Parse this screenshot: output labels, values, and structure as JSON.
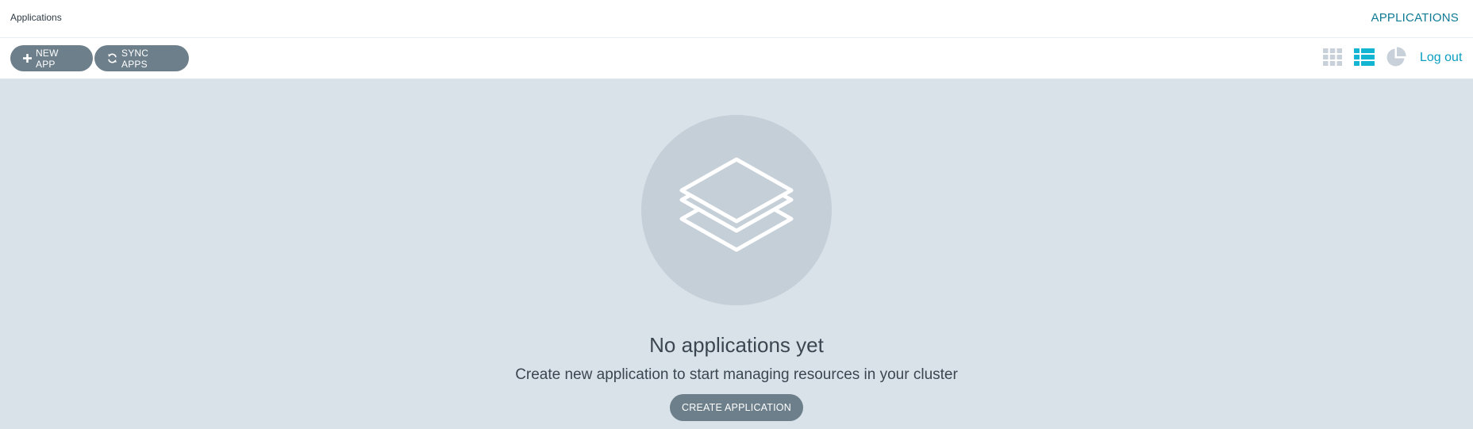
{
  "header": {
    "title": "Applications",
    "nav_link": "APPLICATIONS"
  },
  "toolbar": {
    "new_app_label": "NEW APP",
    "sync_apps_label": "SYNC APPS",
    "views": [
      {
        "name": "tiles",
        "icon": "grid-icon",
        "active": false
      },
      {
        "name": "list",
        "icon": "list-icon",
        "active": true
      },
      {
        "name": "summary",
        "icon": "pie-chart-icon",
        "active": false
      }
    ],
    "logout_label": "Log out"
  },
  "empty_state": {
    "icon": "layers-icon",
    "title": "No applications yet",
    "subtitle": "Create new application to start managing resources in your cluster",
    "button_label": "CREATE APPLICATION"
  },
  "colors": {
    "accent": "#0a9ec2",
    "nav_link": "#0f7b95",
    "button_bg": "#6d7f8b",
    "content_bg": "#dae2e9",
    "circle_bg": "#c5cfd8",
    "icon_inactive": "#c8d1d9"
  }
}
